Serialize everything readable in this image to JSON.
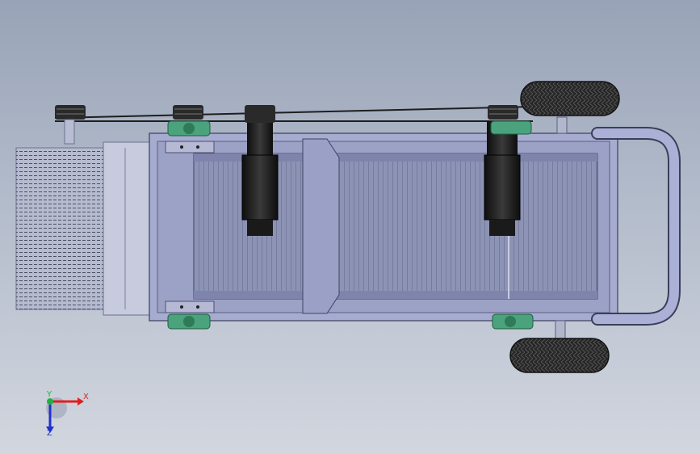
{
  "viewport": {
    "triad": {
      "x_label": "X",
      "y_label": "Y",
      "z_label": "Z"
    }
  },
  "colors": {
    "background_top": "#98a3b7",
    "background_bottom": "#d2d6df",
    "frame": "#9aa0c8",
    "frame_edge": "#3a3f5a",
    "mount_green": "#4aa37d",
    "motor_dark": "#1c1c1c",
    "tire": "#222222",
    "axis_x": "#e02020",
    "axis_y": "#20b040",
    "axis_z": "#2030d0"
  },
  "icons": {
    "triad": "coordinate-triad-icon"
  }
}
